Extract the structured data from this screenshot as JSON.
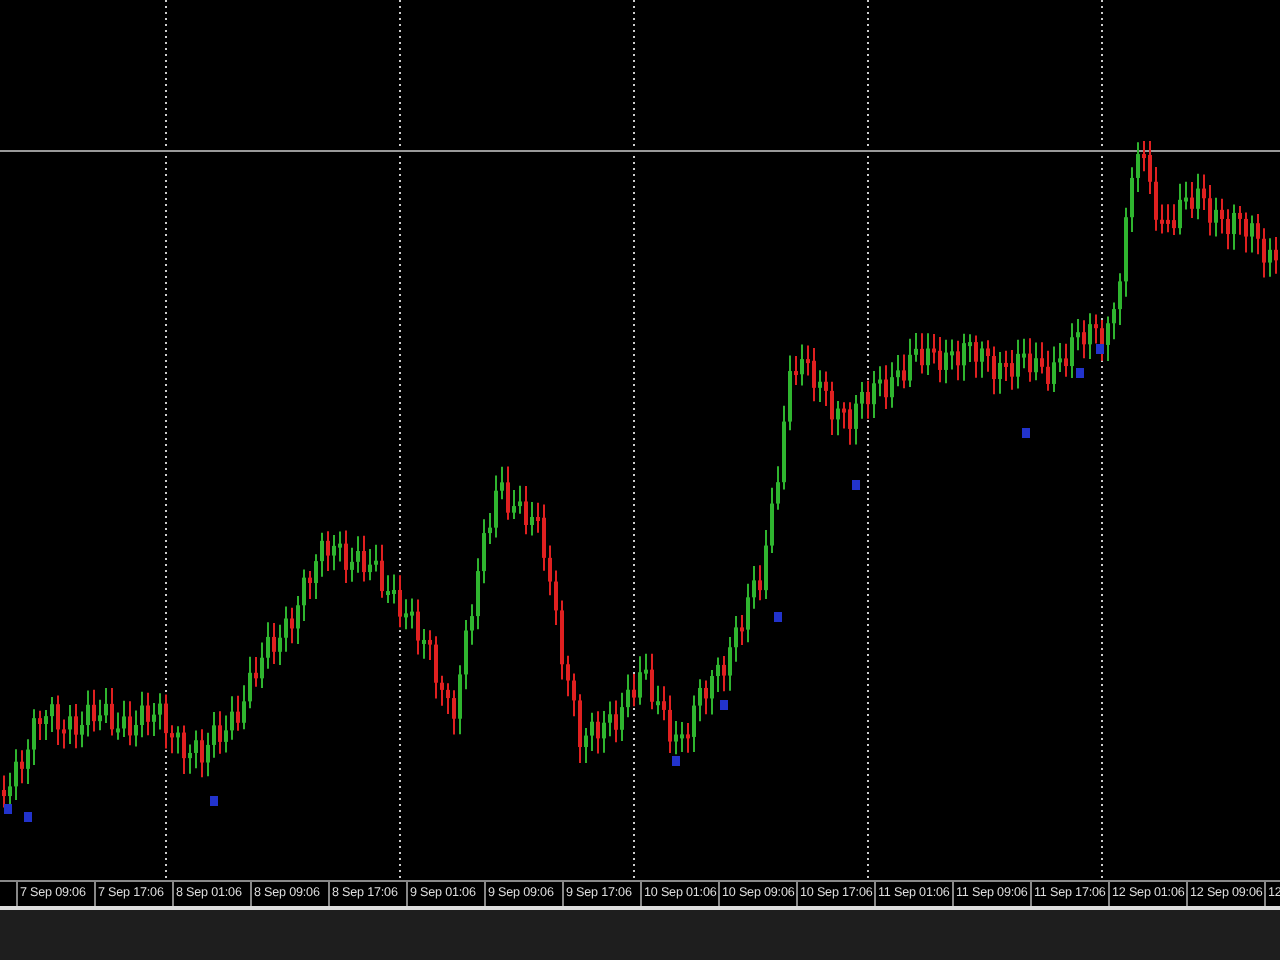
{
  "chart": {
    "time_labels": [
      "7 Sep 09:06",
      "7 Sep 17:06",
      "8 Sep 01:06",
      "8 Sep 09:06",
      "8 Sep 17:06",
      "9 Sep 01:06",
      "9 Sep 09:06",
      "9 Sep 17:06",
      "10 Sep 01:06",
      "10 Sep 09:06",
      "10 Sep 17:06",
      "11 Sep 01:06",
      "11 Sep 09:06",
      "11 Sep 17:06",
      "12 Sep 01:06",
      "12 Sep 09:06",
      "12"
    ]
  }
}
